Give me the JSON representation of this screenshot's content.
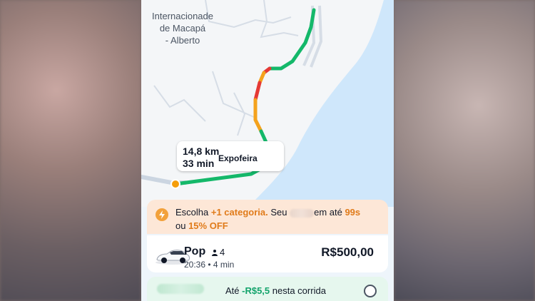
{
  "map": {
    "place_label": "Internacionade\nde Macapá\n- Alberto",
    "tooltip": {
      "distance": "14,8 km",
      "duration": "33 min",
      "destination": "Expofeira"
    }
  },
  "promo": {
    "prefix": "Escolha ",
    "category": "+1 categoria.",
    "middle": " Seu ",
    "suffix": "em até ",
    "seconds": "99s",
    "line2_prefix": "ou ",
    "off": "15% OFF"
  },
  "ride_option": {
    "name": "Pop",
    "seats": "4",
    "eta": "20:36 • 4 min",
    "price": "R$500,00"
  },
  "discount_option": {
    "prefix": "Até ",
    "amount": "-R$5,5",
    "suffix": " nesta corrida"
  },
  "colors": {
    "route_green": "#14b86a",
    "route_red": "#e53935",
    "route_orange": "#f4a21d",
    "promo_bg": "#fde7d7",
    "discount_bg": "#e6f7ee",
    "water": "#cfe7fb"
  },
  "icons": {
    "promo": "lightning-icon",
    "car": "car-icon",
    "seats": "person-icon",
    "radio": "radio-button-icon"
  }
}
